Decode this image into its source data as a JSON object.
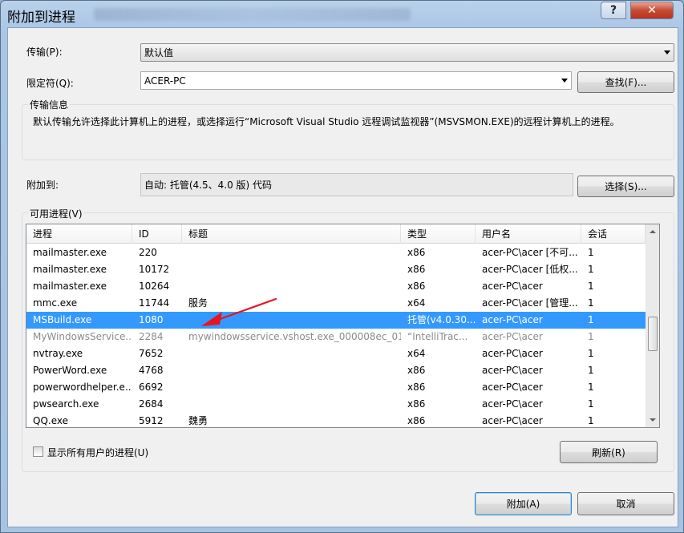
{
  "window": {
    "title": "附加到进程",
    "help_glyph": "?",
    "close_glyph": "✕"
  },
  "transport": {
    "label": "传输(P):",
    "value": "默认值"
  },
  "qualifier": {
    "label": "限定符(Q):",
    "value": "ACER-PC",
    "find_button": "查找(F)..."
  },
  "transport_info": {
    "title": "传输信息",
    "text": "默认传输允许选择此计算机上的进程，或选择运行“Microsoft Visual Studio 远程调试监视器”(MSVSMON.EXE)的远程计算机上的进程。"
  },
  "attach_to": {
    "label": "附加到:",
    "value": "自动: 托管(4.5、4.0 版) 代码",
    "select_button": "选择(S)..."
  },
  "processes": {
    "title": "可用进程(V)",
    "columns": [
      "进程",
      "ID",
      "标题",
      "类型",
      "用户名",
      "会话"
    ],
    "rows": [
      {
        "name": "mailmaster.exe",
        "id": "220",
        "title": "",
        "type": "x86",
        "user": "acer-PC\\acer [不可...",
        "session": "1",
        "state": "normal"
      },
      {
        "name": "mailmaster.exe",
        "id": "10172",
        "title": "",
        "type": "x86",
        "user": "acer-PC\\acer [低权...",
        "session": "1",
        "state": "normal"
      },
      {
        "name": "mailmaster.exe",
        "id": "10264",
        "title": "",
        "type": "x86",
        "user": "acer-PC\\acer",
        "session": "1",
        "state": "normal"
      },
      {
        "name": "mmc.exe",
        "id": "11744",
        "title": "服务",
        "type": "x64",
        "user": "acer-PC\\acer [管理...",
        "session": "1",
        "state": "normal"
      },
      {
        "name": "MSBuild.exe",
        "id": "1080",
        "title": "",
        "type": "托管(v4.0.30...",
        "user": "acer-PC\\acer",
        "session": "1",
        "state": "selected"
      },
      {
        "name": "MyWindowsService....",
        "id": "2284",
        "title": "mywindowsservice.vshost.exe_000008ec_01...",
        "type": "“IntelliTrac...",
        "user": "acer-PC\\acer",
        "session": "1",
        "state": "dim"
      },
      {
        "name": "nvtray.exe",
        "id": "7652",
        "title": "",
        "type": "x64",
        "user": "acer-PC\\acer",
        "session": "1",
        "state": "normal"
      },
      {
        "name": "PowerWord.exe",
        "id": "4768",
        "title": "",
        "type": "x86",
        "user": "acer-PC\\acer",
        "session": "1",
        "state": "normal"
      },
      {
        "name": "powerwordhelper.e...",
        "id": "6692",
        "title": "",
        "type": "x86",
        "user": "acer-PC\\acer",
        "session": "1",
        "state": "normal"
      },
      {
        "name": "pwsearch.exe",
        "id": "2684",
        "title": "",
        "type": "x86",
        "user": "acer-PC\\acer",
        "session": "1",
        "state": "normal"
      },
      {
        "name": "QQ.exe",
        "id": "5912",
        "title": "魏勇",
        "type": "x86",
        "user": "acer-PC\\acer",
        "session": "1",
        "state": "normal"
      }
    ]
  },
  "show_all_users": {
    "label": "显示所有用户的进程(U)",
    "checked": false
  },
  "refresh_button": "刷新(R)",
  "attach_button": "附加(A)",
  "cancel_button": "取消",
  "colors": {
    "selection": "#3399ff",
    "annotation_arrow": "#e8141f"
  }
}
